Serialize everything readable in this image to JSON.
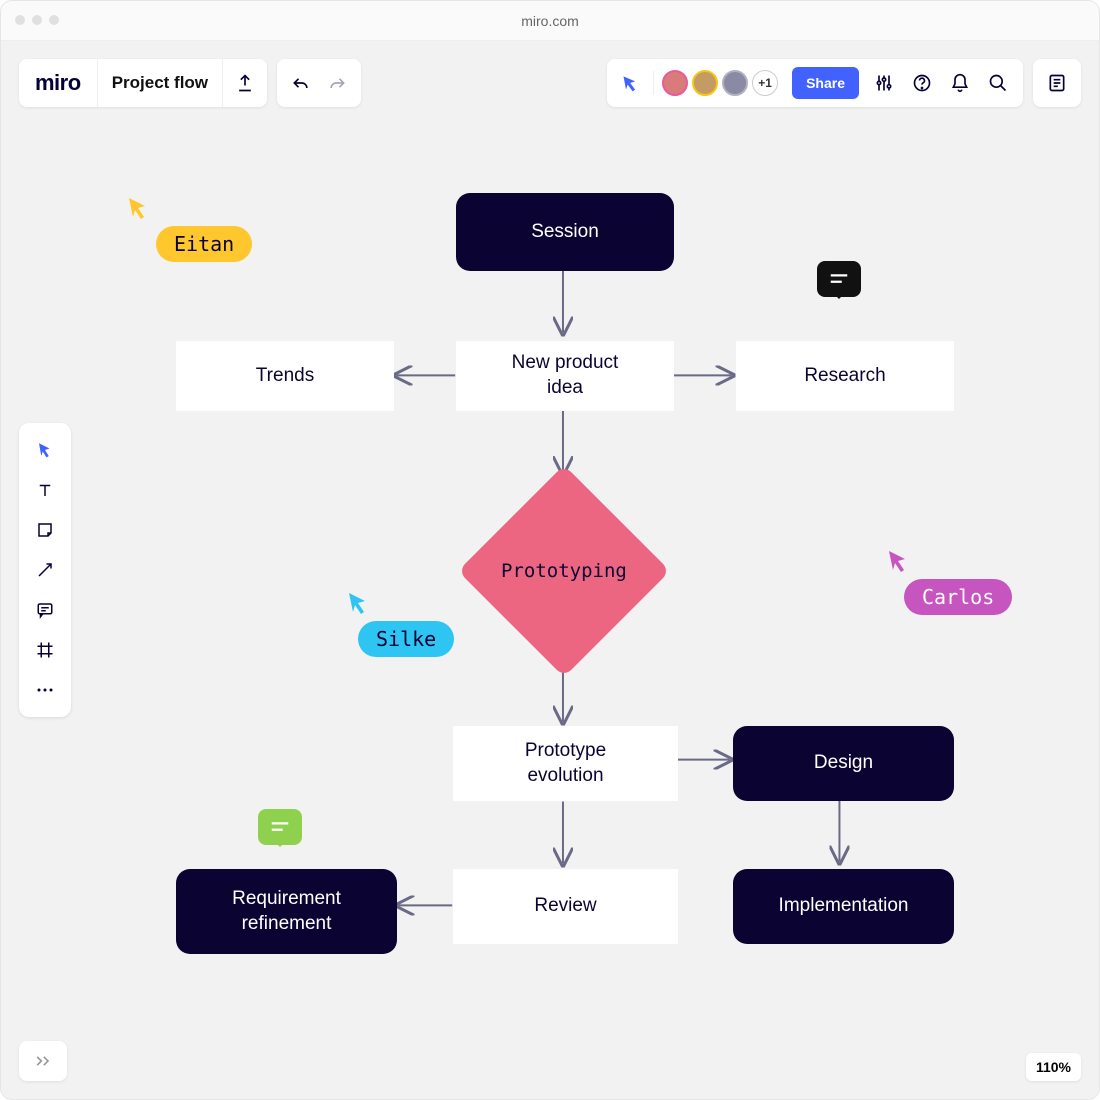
{
  "window": {
    "url": "miro.com"
  },
  "header": {
    "logo": "miro",
    "board_title": "Project flow",
    "share_label": "Share",
    "plus_count": "+1"
  },
  "zoom": {
    "level": "110%"
  },
  "flowchart": {
    "session": "Session",
    "new_idea_l1": "New product",
    "new_idea_l2": "idea",
    "trends": "Trends",
    "research": "Research",
    "prototyping": "Prototyping",
    "proto_evo_l1": "Prototype",
    "proto_evo_l2": "evolution",
    "design": "Design",
    "review": "Review",
    "implementation": "Implementation",
    "req_ref_l1": "Requirement",
    "req_ref_l2": "refinement"
  },
  "cursors": {
    "eitan": "Eitan",
    "silke": "Silke",
    "carlos": "Carlos"
  },
  "colors": {
    "yellow": "#ffc72e",
    "cyan": "#2ec5f3",
    "magenta": "#c655c0"
  }
}
